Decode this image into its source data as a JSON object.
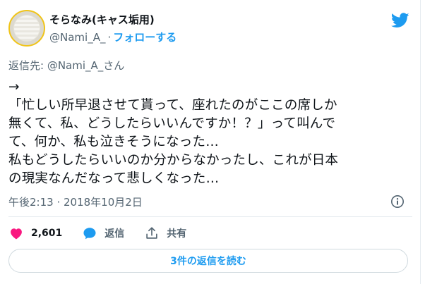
{
  "user": {
    "display_name": "そらなみ(キャス垢用)",
    "handle": "@Nami_A_",
    "separator": "·",
    "follow_label": "フォローする"
  },
  "reply_to": "返信先: @Nami_A_さん",
  "tweet": {
    "text": "→\n「忙しい所早退させて貰って、座れたのがここの席しか\n無くて、私、どうしたらいいんですか！？」って叫んで\nて、何か、私も泣きそうになった…\n私もどうしたらいいのか分からなかったし、これが日本\nの現実なんだなって悲しくなった…",
    "timestamp": "午後2:13 · 2018年10月2日"
  },
  "actions": {
    "likes": "2,601",
    "reply_label": "返信",
    "share_label": "共有"
  },
  "read_replies_label": "3件の返信を読む",
  "colors": {
    "accent": "#1d9bf0",
    "like": "#f91880",
    "text": "#0f1419",
    "muted": "#536471"
  },
  "icons": {
    "brand": "twitter-bird-icon",
    "info": "info-icon",
    "like": "heart-icon",
    "reply": "speech-bubble-icon",
    "share": "share-icon"
  }
}
